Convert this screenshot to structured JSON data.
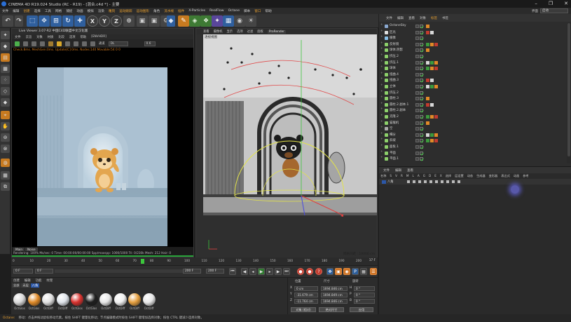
{
  "window": {
    "title": "CINEMA 4D R19.024 Studio (RC - R19) - [混合.c4d *] - 主要"
  },
  "menubar": [
    "文件",
    "编辑",
    "创建",
    "选择",
    "工具",
    "网格",
    "捕捉",
    "动画",
    "模拟",
    "渲染",
    "雕刻",
    "运动跟踪",
    "运动图形",
    "角色",
    "流水线",
    "插件",
    "X-Particles",
    "RealFlow",
    "Octane",
    "脚本",
    "窗口",
    "帮助"
  ],
  "menubar_highlight": [
    "创建",
    "雕刻",
    "运动跟踪",
    "运动图形",
    "流水线",
    "插件",
    "窗口"
  ],
  "layout": {
    "label": "界面",
    "value": "启动"
  },
  "toolbar": {
    "undo_icon": "undo-icon",
    "axis_buttons": [
      "X",
      "Y",
      "Z"
    ]
  },
  "live_viewer": {
    "title": "Live Viewer 3.07-R2 中国C4D联盟中文汉化版",
    "menu": [
      "文件",
      "云渲",
      "对象",
      "材质",
      "比较",
      "选项",
      "帮助",
      "[ENVHDR]"
    ],
    "channel": "DL",
    "mode_label": "通道",
    "value": "0.6",
    "status": "Check:8ms. MeshGen:0ms. Update[C]:0ms. Nodes:140 Movable:54 0 0",
    "tabs": [
      "Main",
      "Noise"
    ],
    "footer": "Rendering: 100%  Ms/sec: 0  Time: 00:00:00/00:00:00  Spp/maxspp: 1000/1000  Tri: 0/230k  Mesh: 212  Hair: 0"
  },
  "viewport": {
    "menu": [
      "查看",
      "摄像机",
      "显示",
      "选项",
      "过滤",
      "面板",
      "ProRender"
    ],
    "label": "透视视图",
    "grid_distance": "网格间距 : 10000 cm"
  },
  "timeline": {
    "ticks": [
      "0",
      "10",
      "20",
      "30",
      "40",
      "50",
      "60",
      "70",
      "80",
      "90",
      "100",
      "110",
      "120",
      "130",
      "140",
      "150",
      "160",
      "170",
      "180",
      "190",
      "200"
    ],
    "current_frame": "17 F",
    "start": "0 F",
    "current": "0 F",
    "end_a": "200 F",
    "end_b": "200 F",
    "playhead": 73
  },
  "materials": {
    "menu": [
      "创建",
      "编辑",
      "功能",
      "纹理"
    ],
    "tabs": [
      "全部",
      "无层",
      "八角"
    ],
    "active_tab": "八角",
    "swatches": [
      {
        "name": "OctGlos",
        "color": "#d9d9d9"
      },
      {
        "name": "OctGlos",
        "color": "#e08a28"
      },
      {
        "name": "OctDiff",
        "color": "#e0e0e0"
      },
      {
        "name": "OctDiff",
        "color": "#dfe4ea"
      },
      {
        "name": "OctGlos",
        "color": "#d8322e"
      },
      {
        "name": "OctGlos",
        "color": "#1e1e1e"
      },
      {
        "name": "OctDiff",
        "color": "#e6e6e6"
      },
      {
        "name": "OctDiff",
        "color": "#f0f0f0"
      },
      {
        "name": "OctDiff",
        "color": "#e6a040"
      },
      {
        "name": "OctDiff",
        "color": "#e8e8e8"
      }
    ]
  },
  "coordinates": {
    "headers": [
      "位置",
      "尺寸",
      "旋转"
    ],
    "rows": [
      {
        "axis": "X",
        "pos": "0 cm",
        "size": "1694.846 cm",
        "rlabel": "H",
        "rot": "0 °"
      },
      {
        "axis": "Y",
        "pos": "-31.679 cm",
        "size": "1694.849 cm",
        "rlabel": "P",
        "rot": "0 °"
      },
      {
        "axis": "Z",
        "pos": "-11.764 cm",
        "size": "1694.846 cm",
        "rlabel": "B",
        "rot": "0 °"
      }
    ],
    "mode_a": "对象 (相对)",
    "mode_b": "绝对尺寸",
    "apply": "应用"
  },
  "object_manager": {
    "menu": [
      "文件",
      "编辑",
      "查看",
      "对象",
      "标签",
      "书签"
    ],
    "menu_highlight": [
      "标签"
    ],
    "objects": [
      {
        "name": "OctaneSky",
        "indent": 1,
        "color": "#8aa8d0"
      },
      {
        "name": "区光",
        "indent": 1,
        "color": "#ddd"
      },
      {
        "name": "摄像",
        "indent": 1,
        "color": "#88c0e8"
      },
      {
        "name": "反射镜",
        "indent": 1,
        "color": "#8ccf6a"
      },
      {
        "name": "球体.阴影",
        "indent": 1,
        "color": "#8ccf6a"
      },
      {
        "name": "挤压.2",
        "indent": 1,
        "color": "#8ccf6a"
      },
      {
        "name": "挤压.1",
        "indent": 1,
        "color": "#8ccf6a"
      },
      {
        "name": "球体",
        "indent": 1,
        "color": "#8ccf6a"
      },
      {
        "name": "扭曲.4",
        "indent": 1,
        "color": "#8ccf6a"
      },
      {
        "name": "扭曲.3",
        "indent": 1,
        "color": "#8ccf6a"
      },
      {
        "name": "立体",
        "indent": 1,
        "color": "#8ccf6a"
      },
      {
        "name": "挤压.2",
        "indent": 1,
        "color": "#8ccf6a"
      },
      {
        "name": "圆柱.3",
        "indent": 1,
        "color": "#8ccf6a"
      },
      {
        "name": "圆柱.2.副本.1",
        "indent": 1,
        "color": "#8ccf6a"
      },
      {
        "name": "圆柱.2.副本",
        "indent": 1,
        "color": "#8ccf6a"
      },
      {
        "name": "克隆.2",
        "indent": 1,
        "color": "#8ccf6a"
      },
      {
        "name": "猫猴机",
        "indent": 1,
        "color": "#8ccf6a"
      },
      {
        "name": "空",
        "indent": 1,
        "color": "#aaa"
      },
      {
        "name": "细分",
        "indent": 1,
        "color": "#8ccf6a"
      },
      {
        "name": "斜坡",
        "indent": 1,
        "color": "#8ccf6a"
      },
      {
        "name": "面板.1",
        "indent": 1,
        "color": "#8ccf6a"
      },
      {
        "name": "平面",
        "indent": 1,
        "color": "#8ccf6a"
      },
      {
        "name": "平面.1",
        "indent": 1,
        "color": "#8ccf6a"
      }
    ]
  },
  "attributes": {
    "tabs": [
      "文件",
      "编辑",
      "查看"
    ],
    "columns": [
      "名称",
      "S",
      "V",
      "R",
      "M",
      "L",
      "A",
      "G",
      "D",
      "E",
      "X",
      "选择",
      "层设置",
      "动态",
      "生成器",
      "变形器",
      "表达式",
      "动画",
      "参考"
    ],
    "layer_name": "八角"
  },
  "status": {
    "text": "移动：点击并拖动鼠标移动元素。按住 SHIFT 键量化移动；节点编辑模式时按住 SHIFT 键增加选择对象；按住 CTRL 键减少选择对象。"
  }
}
